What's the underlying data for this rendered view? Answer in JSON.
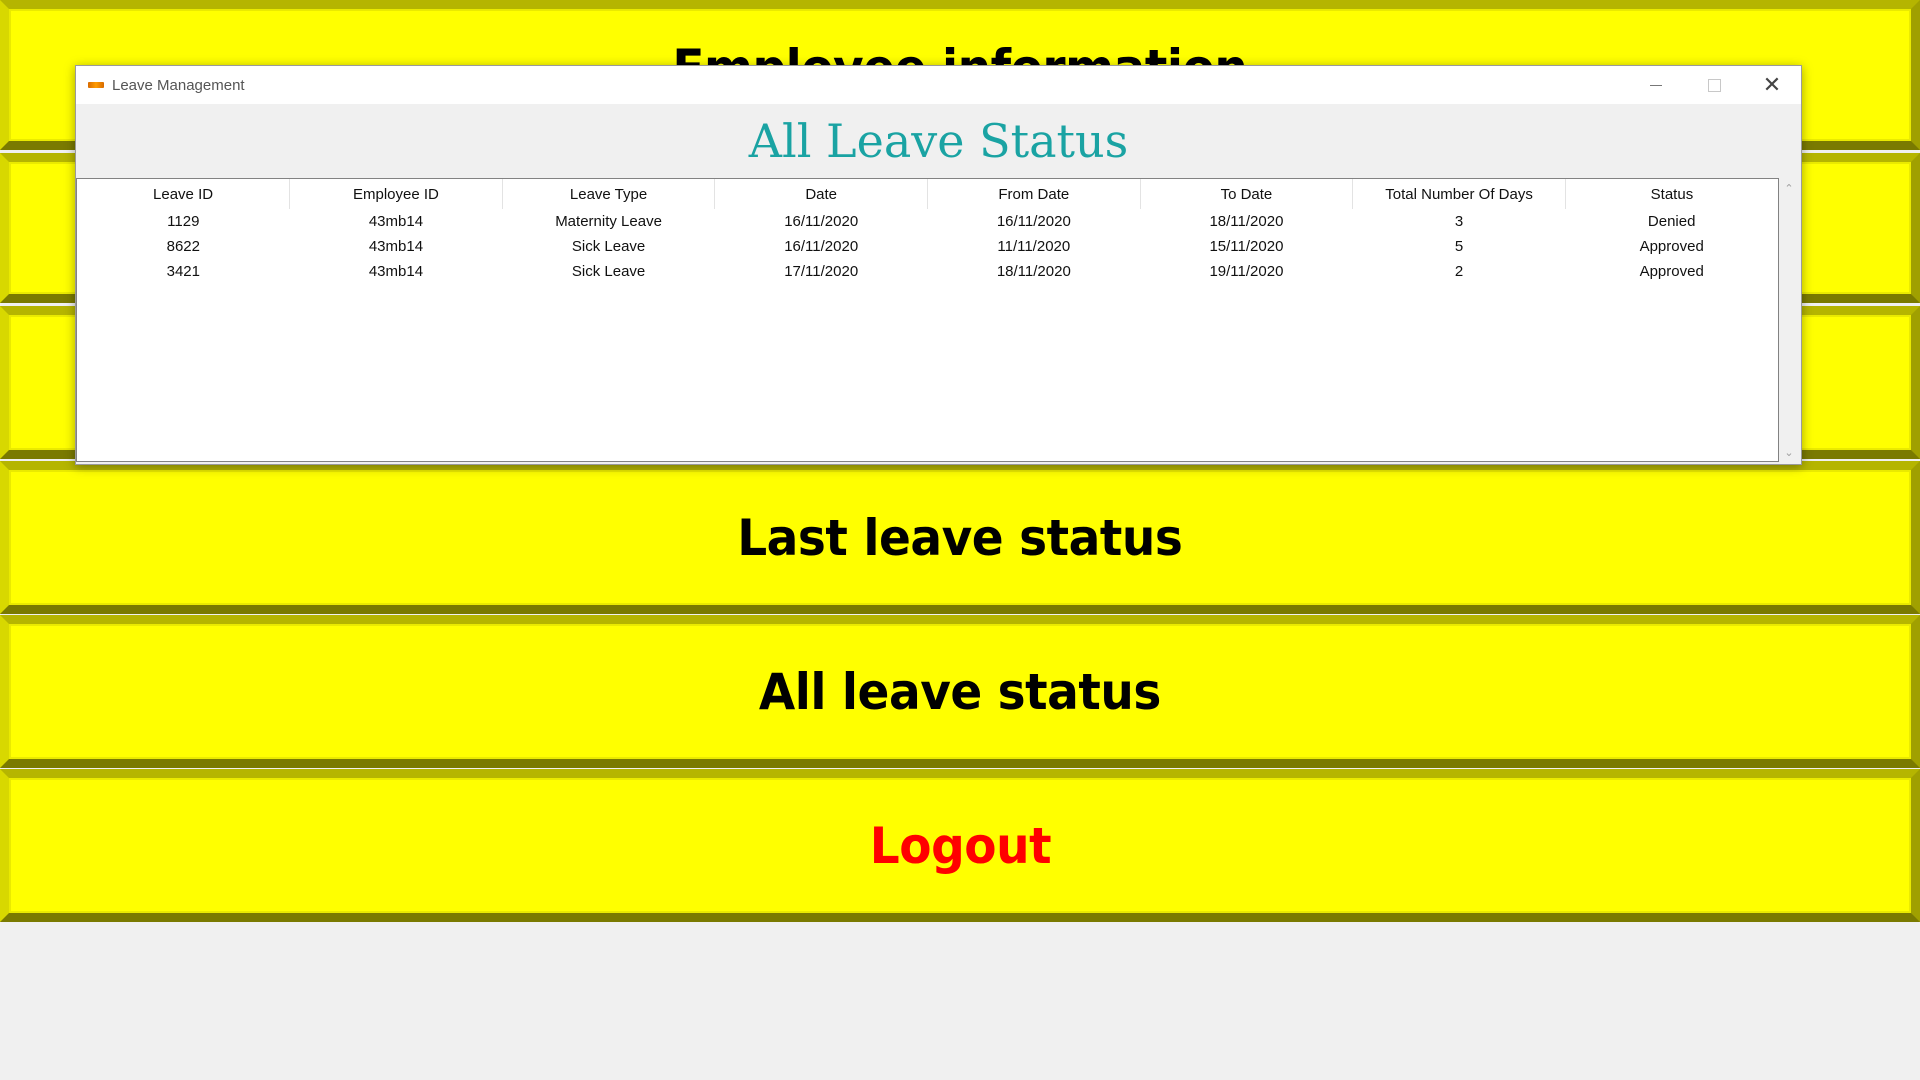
{
  "background_buttons": {
    "employee_info": "Employee information",
    "last_leave": "Last leave status",
    "all_leave": "All leave status",
    "logout": "Logout"
  },
  "window": {
    "title": "Leave Management",
    "heading": "All Leave Status",
    "controls": {
      "minimize": "minimize-icon",
      "maximize": "maximize-icon",
      "close": "close-icon"
    }
  },
  "table": {
    "columns": [
      "Leave ID",
      "Employee ID",
      "Leave Type",
      "Date",
      "From Date",
      "To Date",
      "Total Number Of Days",
      "Status"
    ],
    "rows": [
      [
        "1129",
        "43mb14",
        "Maternity Leave",
        "16/11/2020",
        "16/11/2020",
        "18/11/2020",
        "3",
        "Denied"
      ],
      [
        "8622",
        "43mb14",
        "Sick Leave",
        "16/11/2020",
        "11/11/2020",
        "15/11/2020",
        "5",
        "Approved"
      ],
      [
        "3421",
        "43mb14",
        "Sick Leave",
        "17/11/2020",
        "18/11/2020",
        "19/11/2020",
        "2",
        "Approved"
      ]
    ]
  },
  "colors": {
    "button_bg": "#ffff00",
    "heading": "#1aa3a3",
    "logout_text": "#ff0000"
  }
}
